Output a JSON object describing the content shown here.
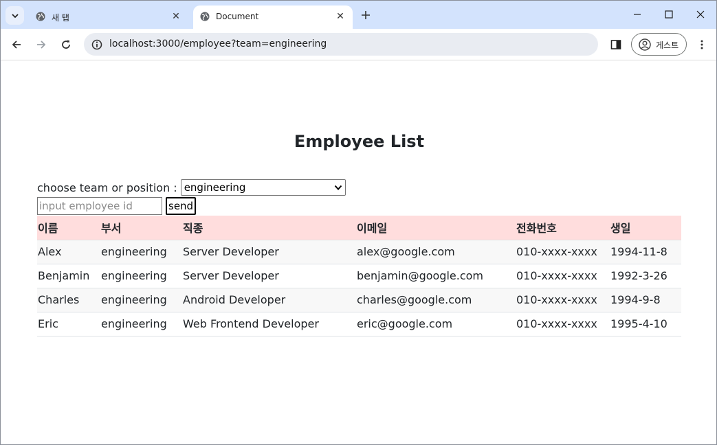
{
  "browser": {
    "tabs": [
      {
        "title": "새 탭",
        "active": false
      },
      {
        "title": "Document",
        "active": true
      }
    ],
    "url": "localhost:3000/employee?team=engineering",
    "profile_label": "게스트",
    "icons": {
      "tab_search": "chevron-down-icon",
      "favicon": "globe-icon",
      "close": "close-icon",
      "new_tab": "plus-icon",
      "back": "arrow-left-icon",
      "forward": "arrow-right-icon",
      "reload": "reload-icon",
      "site_info": "info-icon",
      "side_panel": "side-panel-icon",
      "avatar": "person-icon",
      "menu": "kebab-menu-icon"
    },
    "colors": {
      "tabstrip": "#d3e3fd",
      "omnibox": "#e9ecf2"
    }
  },
  "page": {
    "title": "Employee List",
    "filter": {
      "label": "choose team or position :",
      "selected": "engineering"
    },
    "search": {
      "placeholder": "input employee id",
      "value": "",
      "button_label": "send"
    },
    "table": {
      "header_color": "#ffdddd",
      "columns": [
        "이름",
        "부서",
        "직종",
        "이메일",
        "전화번호",
        "생일"
      ],
      "rows": [
        [
          "Alex",
          "engineering",
          "Server Developer",
          "alex@google.com",
          "010-xxxx-xxxx",
          "1994-11-8"
        ],
        [
          "Benjamin",
          "engineering",
          "Server Developer",
          "benjamin@google.com",
          "010-xxxx-xxxx",
          "1992-3-26"
        ],
        [
          "Charles",
          "engineering",
          "Android Developer",
          "charles@google.com",
          "010-xxxx-xxxx",
          "1994-9-8"
        ],
        [
          "Eric",
          "engineering",
          "Web Frontend Developer",
          "eric@google.com",
          "010-xxxx-xxxx",
          "1995-4-10"
        ]
      ]
    }
  }
}
